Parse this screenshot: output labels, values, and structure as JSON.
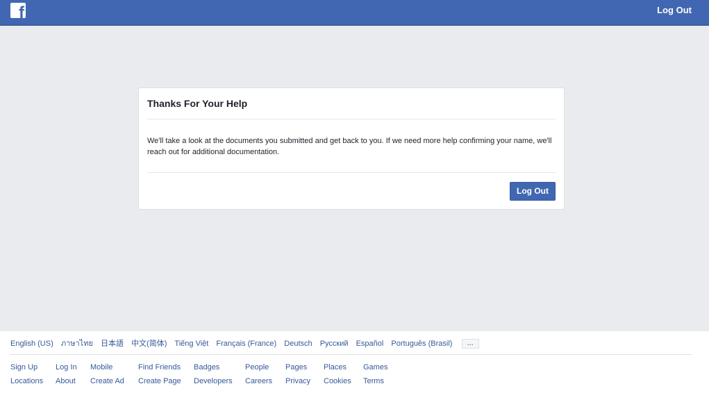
{
  "topbar": {
    "logo_glyph": "f",
    "logout_label": "Log Out"
  },
  "dialog": {
    "title": "Thanks For Your Help",
    "body": "We'll take a look at the documents you submitted and get back to you. If we need more help confirming your name, we'll reach out for additional documentation.",
    "logout_label": "Log Out"
  },
  "footer": {
    "languages": [
      "English (US)",
      "ภาษาไทย",
      "日本語",
      "中文(简体)",
      "Tiếng Việt",
      "Français (France)",
      "Deutsch",
      "Русский",
      "Español",
      "Português (Brasil)"
    ],
    "more_label": "...",
    "links_row1": [
      "Sign Up",
      "Log In",
      "Mobile",
      "Find Friends",
      "Badges",
      "People",
      "Pages",
      "Places",
      "Games"
    ],
    "links_row2": [
      "Locations",
      "About",
      "Create Ad",
      "Create Page",
      "Developers",
      "Careers",
      "Privacy",
      "Cookies",
      "Terms"
    ]
  },
  "colors": {
    "brand": "#4267b2",
    "background": "#e9ebee",
    "link": "#365899"
  },
  "icons": {
    "logo": "facebook-logo-icon"
  }
}
